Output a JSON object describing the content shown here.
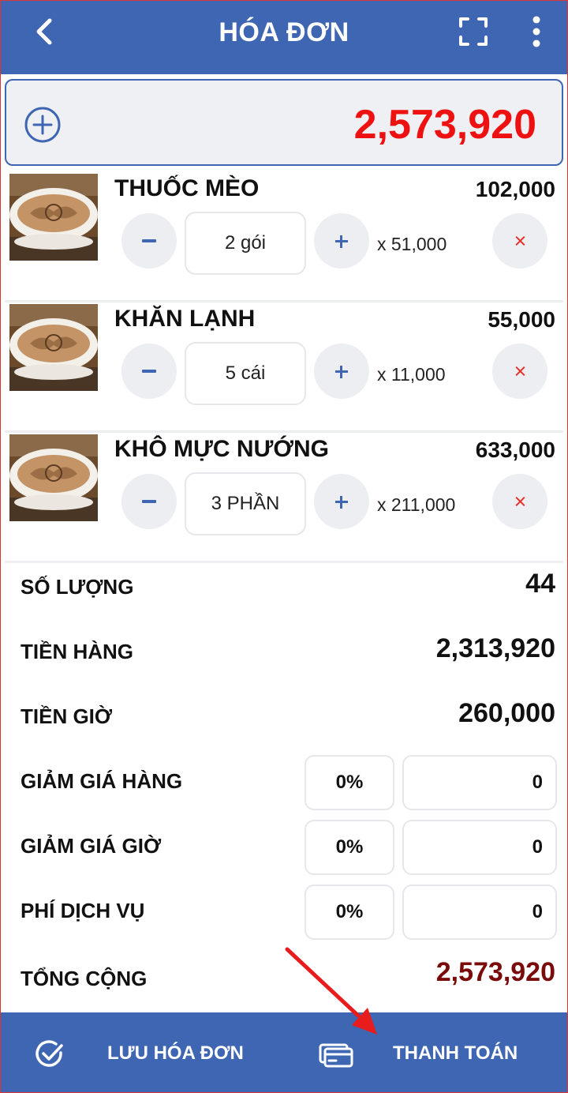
{
  "header": {
    "title": "HÓA ĐƠN"
  },
  "total_bar": {
    "amount": "2,573,920"
  },
  "items": [
    {
      "name": "THUỐC MÈO",
      "price": "102,000",
      "quantity": "2 gói",
      "unit_price": "x 51,000"
    },
    {
      "name": "KHĂN LẠNH",
      "price": "55,000",
      "quantity": "5 cái",
      "unit_price": "x 11,000"
    },
    {
      "name": "KHÔ MỰC NƯỚNG",
      "price": "633,000",
      "quantity": "3 PHẦN",
      "unit_price": "x 211,000"
    }
  ],
  "summary": {
    "quantity": {
      "label": "SỐ LƯỢNG",
      "value": "44"
    },
    "goods_amount": {
      "label": "TIỀN HÀNG",
      "value": "2,313,920"
    },
    "time_amount": {
      "label": "TIỀN GIỜ",
      "value": "260,000"
    },
    "goods_discount": {
      "label": "GIẢM GIÁ HÀNG",
      "percent": "0%",
      "amount": "0"
    },
    "time_discount": {
      "label": "GIẢM GIÁ GIỜ",
      "percent": "0%",
      "amount": "0"
    },
    "service_fee": {
      "label": "PHÍ DỊCH VỤ",
      "percent": "0%",
      "amount": "0"
    },
    "total": {
      "label": "TỔNG CỘNG",
      "value": "2,573,920"
    }
  },
  "bottom_bar": {
    "save_label": "LƯU HÓA ĐƠN",
    "pay_label": "THANH TOÁN"
  },
  "colors": {
    "primary": "#3f66b2",
    "total_red": "#ee1111",
    "grand_total": "#7a0b0b",
    "remove_red": "#e5302a",
    "annotation_arrow": "#e81c1c"
  },
  "icons": {
    "back": "chevron-left-icon",
    "fullscreen": "fullscreen-icon",
    "more": "more-vertical-icon",
    "add": "plus-circle-icon",
    "save": "check-circle-icon",
    "pay": "credit-card-icon"
  }
}
